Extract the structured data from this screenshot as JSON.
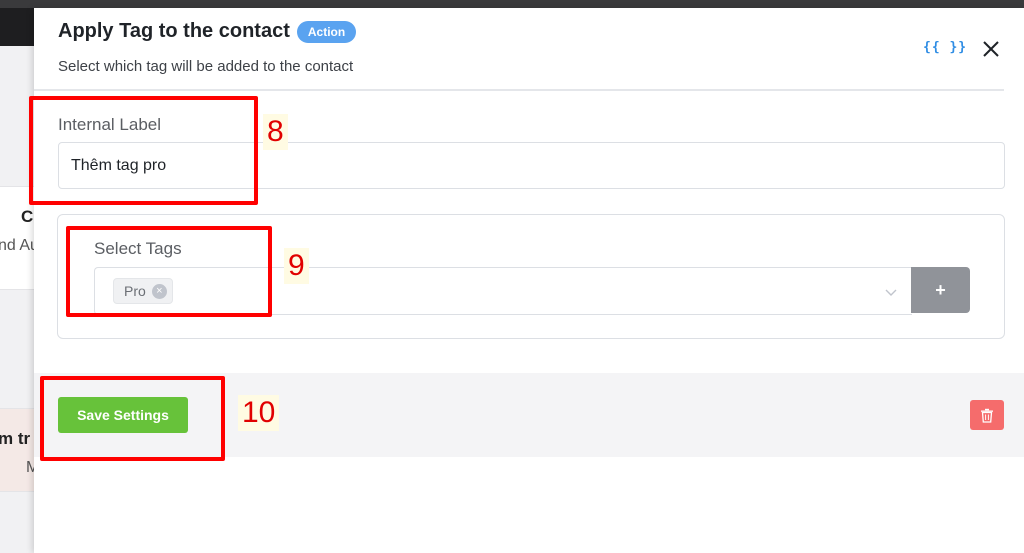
{
  "background": {
    "card1_line1": "C",
    "card1_line2": "nd Au",
    "card2_line1": "m tr",
    "card2_line2": "M"
  },
  "drawer": {
    "title": "Apply Tag to the contact",
    "badge": "Action",
    "subtitle": "Select which tag will be added to the contact",
    "smart_codes_label": "{{ }}",
    "internal_label": {
      "label": "Internal Label",
      "value": "Thêm tag pro"
    },
    "select_tags": {
      "label": "Select Tags",
      "selected": [
        "Pro"
      ],
      "add_label": "+"
    },
    "footer": {
      "save_label": "Save Settings"
    }
  },
  "annotations": [
    "8",
    "9",
    "10"
  ],
  "icons": {
    "close": "close-icon",
    "chevron": "chevron-down-icon",
    "remove_chip": "close-circle-icon",
    "delete": "trash-icon",
    "smart_codes": "curly-braces-icon"
  },
  "colors": {
    "badge": "#5aa3f0",
    "save": "#67c23a",
    "delete": "#f56c6c",
    "add_tag": "#909399",
    "annotation": "#ff0000",
    "smart_codes": "#2f8de4"
  }
}
